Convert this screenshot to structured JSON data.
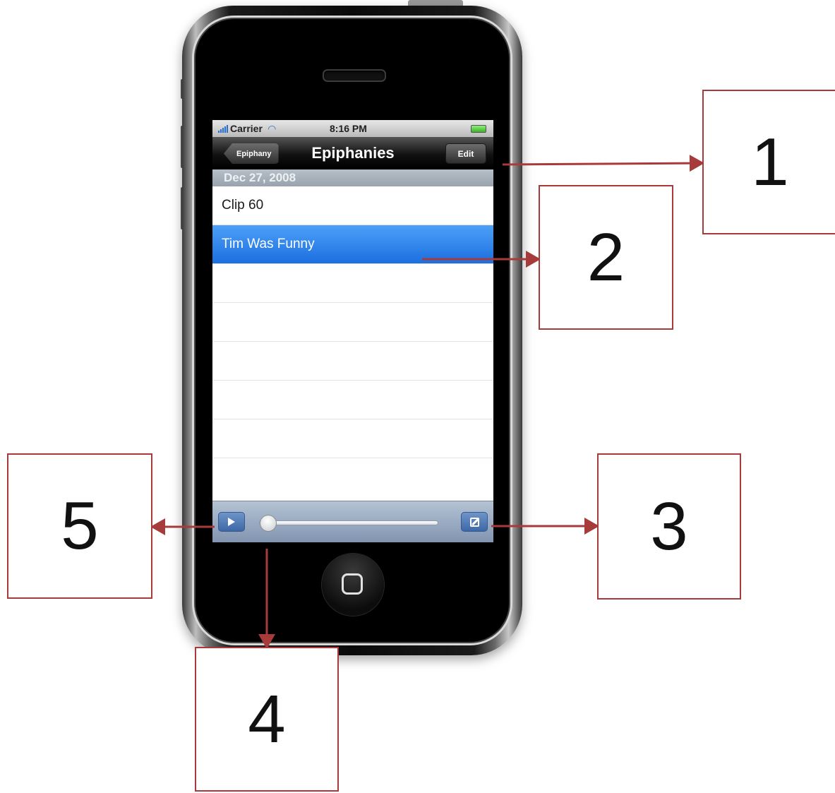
{
  "status_bar": {
    "carrier": "Carrier",
    "time": "8:16 PM"
  },
  "nav_bar": {
    "back_label": "Epiphany",
    "title": "Epiphanies",
    "edit_label": "Edit"
  },
  "list": {
    "section_header": "Dec 27, 2008",
    "items": [
      {
        "label": "Clip 60",
        "selected": false
      },
      {
        "label": "Tim Was Funny",
        "selected": true
      }
    ]
  },
  "toolbar": {
    "play_icon": "play-icon",
    "compose_icon": "compose-icon",
    "playback_progress": 0.0
  },
  "callouts": {
    "c1": "1",
    "c2": "2",
    "c3": "3",
    "c4": "4",
    "c5": "5"
  },
  "colors": {
    "callout_border": "#a73b3b",
    "selection": "#2f86ee"
  }
}
